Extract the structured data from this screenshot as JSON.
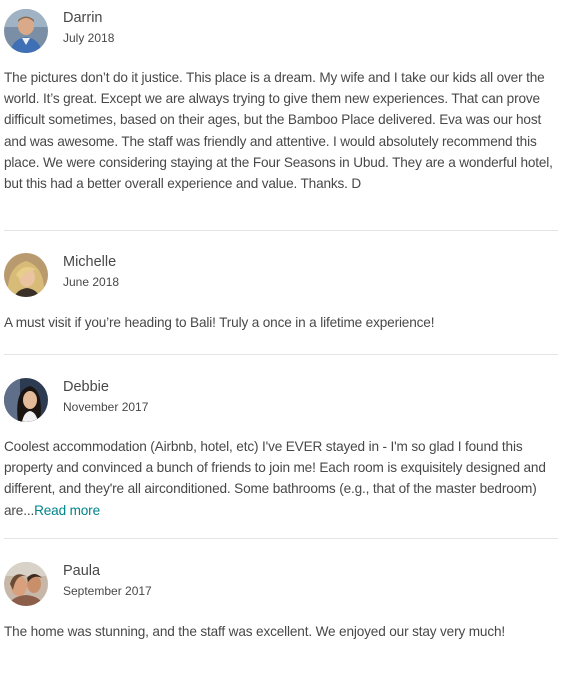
{
  "reviews": [
    {
      "name": "Darrin",
      "date": "July 2018",
      "text": "The pictures don’t do it justice. This place is a dream. My wife and I take our kids all over the world. It’s great. Except we are always trying to give them new experiences. That can prove difficult sometimes, based on their ages, but the Bamboo Place delivered. Eva was our host and was awesome. The staff was friendly and attentive. I would absolutely recommend this place. We were considering staying at the Four Seasons in Ubud. They are a wonderful hotel, but this had a better overall experience and value. Thanks. D",
      "read_more": ""
    },
    {
      "name": "Michelle",
      "date": "June 2018",
      "text": "A must visit if you’re heading to Bali! Truly a once in a lifetime experience!",
      "read_more": ""
    },
    {
      "name": "Debbie",
      "date": "November 2017",
      "text": "Coolest accommodation (Airbnb, hotel, etc) I've EVER stayed in - I'm so glad I found this property and convinced a bunch of friends to join me! Each room is exquisitely designed and different, and they're all airconditioned. Some bathrooms (e.g., that of the master bedroom) are...",
      "read_more": "Read more"
    },
    {
      "name": "Paula",
      "date": "September 2017",
      "text": "The home was stunning, and the staff was excellent. We enjoyed our stay very much!",
      "read_more": ""
    }
  ],
  "colors": {
    "text": "#484848",
    "link": "#008489",
    "divider": "#e4e4e4"
  }
}
